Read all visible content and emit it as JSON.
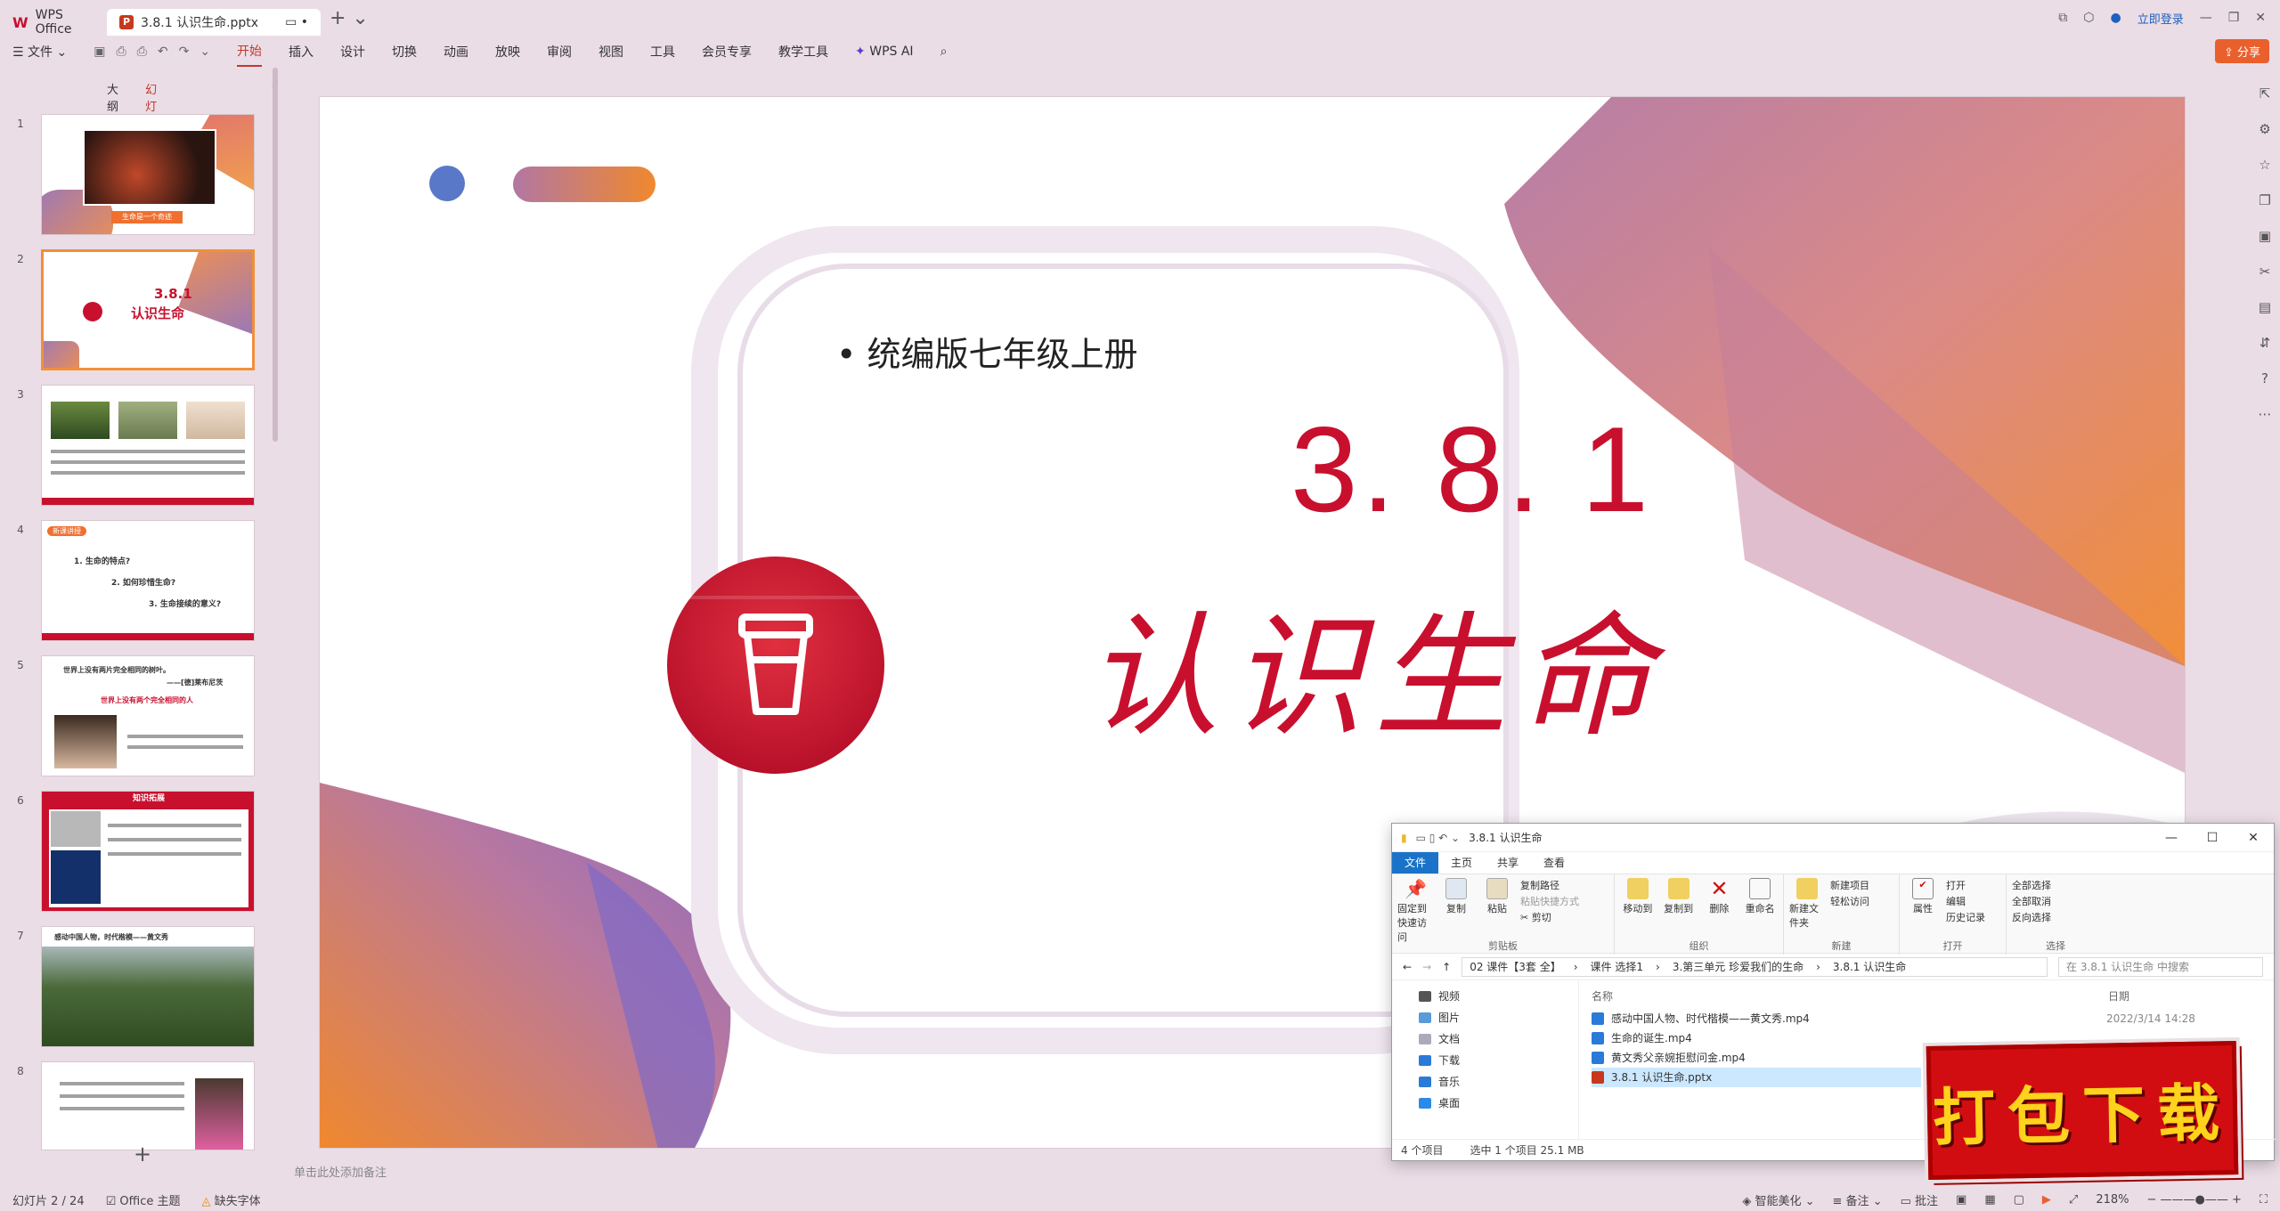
{
  "titlebar": {
    "home_tab": "WPS Office",
    "doc_tab": "3.8.1 认识生命.pptx",
    "login": "立即登录",
    "share": "分享"
  },
  "menu": {
    "file": "文件",
    "items": [
      "开始",
      "插入",
      "设计",
      "切换",
      "动画",
      "放映",
      "审阅",
      "视图",
      "工具",
      "会员专享",
      "教学工具"
    ],
    "ai": "WPS AI"
  },
  "sidepanel": {
    "tab_outline": "大纲",
    "tab_slides": "幻灯片",
    "slide_numbers": [
      "1",
      "2",
      "3",
      "4",
      "5",
      "6",
      "7",
      "8"
    ],
    "thumb1_caption": "生命是一个奇迹",
    "thumb2_title": "3.8.1",
    "thumb2_subtitle": "认识生命",
    "thumb4_tag": "新课讲授",
    "thumb4_q1": "1. 生命的特点?",
    "thumb4_q2": "2. 如何珍惜生命?",
    "thumb4_q3": "3. 生命接续的意义?",
    "thumb5_quote": "世界上没有两片完全相同的树叶。",
    "thumb5_author": "——[德]莱布尼茨",
    "thumb5_red": "世界上没有两个完全相同的人",
    "thumb6_title": "知识拓展",
    "thumb7_title": "感动中国人物，时代楷模——黄文秀"
  },
  "slide": {
    "bullet": "统编版七年级上册",
    "number": "3. 8. 1",
    "title": "认识生命"
  },
  "notes_placeholder": "单击此处添加备注",
  "status": {
    "slide_counter": "幻灯片 2 / 24",
    "theme": "Office 主题",
    "missing_font": "缺失字体",
    "beautify": "智能美化",
    "notes": "备注",
    "comments": "批注",
    "zoom": "218%"
  },
  "explorer": {
    "title": "3.8.1 认识生命",
    "tabs": [
      "文件",
      "主页",
      "共享",
      "查看"
    ],
    "ribbon": {
      "pin": "固定到快速访问",
      "copy": "复制",
      "paste": "粘贴",
      "copy_path": "复制路径",
      "paste_shortcut": "粘贴快捷方式",
      "cut": "剪切",
      "clipboard": "剪贴板",
      "move_to": "移动到",
      "copy_to": "复制到",
      "delete": "删除",
      "rename": "重命名",
      "organize": "组织",
      "new_folder": "新建文件夹",
      "new_item": "新建项目",
      "easy_access": "轻松访问",
      "new": "新建",
      "properties": "属性",
      "open": "打开",
      "edit": "编辑",
      "history": "历史记录",
      "open_group": "打开",
      "select_all": "全部选择",
      "select_none": "全部取消",
      "invert": "反向选择",
      "select": "选择"
    },
    "path": [
      "02 课件【3套 全】",
      "课件 选择1",
      "3.第三单元 珍爱我们的生命",
      "3.8.1 认识生命"
    ],
    "search_placeholder": "在 3.8.1 认识生命 中搜索",
    "nav": [
      "视频",
      "图片",
      "文档",
      "下载",
      "音乐",
      "桌面"
    ],
    "col_name": "名称",
    "col_date": "日期",
    "files": [
      {
        "name": "感动中国人物、时代楷模——黄文秀.mp4",
        "date": "2022/3/14 14:28"
      },
      {
        "name": "生命的诞生.mp4",
        "date": ""
      },
      {
        "name": "黄文秀父亲婉拒慰问金.mp4",
        "date": ""
      },
      {
        "name": "3.8.1 认识生命.pptx",
        "date": ""
      }
    ],
    "count": "4 个项目",
    "selection": "选中 1 个项目  25.1 MB"
  },
  "badge": "打包下载",
  "colors": {
    "accent_red": "#c0392b",
    "slide_red": "#c8102e",
    "orange": "#f0903a",
    "purple": "#9a78b8"
  }
}
